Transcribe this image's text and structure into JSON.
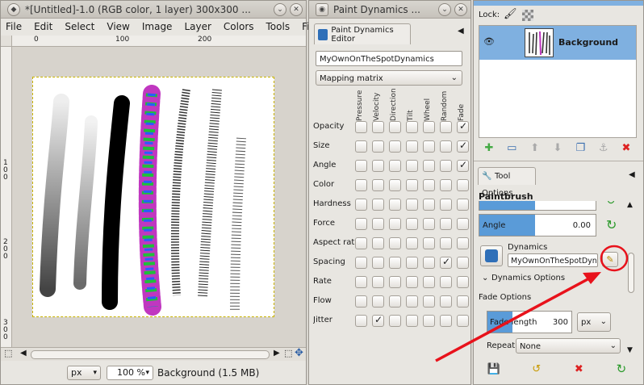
{
  "image_window": {
    "title": "*[Untitled]-1.0 (RGB color, 1 layer) 300x300 ...",
    "menu": [
      "File",
      "Edit",
      "Select",
      "View",
      "Image",
      "Layer",
      "Colors",
      "Tools",
      "Filt"
    ],
    "ruler_top": [
      "0",
      "100",
      "200"
    ],
    "ruler_left": [
      "1\n0\n0",
      "2\n0\n0",
      "3\n0\n0"
    ],
    "unit": "px",
    "zoom": "100 %",
    "status": "Background (1.5 MB)"
  },
  "dynamics_editor": {
    "title": "Paint Dynamics ...",
    "tab_label": "Paint Dynamics Editor",
    "name_value": "MyOwnOnTheSpotDynamics",
    "mode": "Mapping matrix",
    "columns": [
      "Pressure",
      "Velocity",
      "Direction",
      "Tilt",
      "Wheel",
      "Random",
      "Fade"
    ],
    "rows": [
      {
        "label": "Opacity",
        "checks": [
          false,
          false,
          false,
          false,
          false,
          false,
          true
        ]
      },
      {
        "label": "Size",
        "checks": [
          false,
          false,
          false,
          false,
          false,
          false,
          true
        ]
      },
      {
        "label": "Angle",
        "checks": [
          false,
          false,
          false,
          false,
          false,
          false,
          true
        ]
      },
      {
        "label": "Color",
        "checks": [
          false,
          false,
          false,
          false,
          false,
          false,
          false
        ]
      },
      {
        "label": "Hardness",
        "checks": [
          false,
          false,
          false,
          false,
          false,
          false,
          false
        ]
      },
      {
        "label": "Force",
        "checks": [
          false,
          false,
          false,
          false,
          false,
          false,
          false
        ]
      },
      {
        "label": "Aspect ratio",
        "checks": [
          false,
          false,
          false,
          false,
          false,
          false,
          false
        ]
      },
      {
        "label": "Spacing",
        "checks": [
          false,
          false,
          false,
          false,
          false,
          true,
          false
        ]
      },
      {
        "label": "Rate",
        "checks": [
          false,
          false,
          false,
          false,
          false,
          false,
          false
        ]
      },
      {
        "label": "Flow",
        "checks": [
          false,
          false,
          false,
          false,
          false,
          false,
          false
        ]
      },
      {
        "label": "Jitter",
        "checks": [
          false,
          true,
          false,
          false,
          false,
          false,
          false
        ]
      }
    ]
  },
  "layers": {
    "lock_label": "Lock:",
    "layer_name": "Background"
  },
  "tool_options": {
    "tab_label": "Tool Options",
    "tool_name": "Paintbrush",
    "angle_label": "Angle",
    "angle_value": "0.00",
    "dynamics_label": "Dynamics",
    "dynamics_value": "MyOwnOnTheSpotDynam",
    "dynamics_options_label": "Dynamics Options",
    "fade_options_label": "Fade Options",
    "fade_length_label": "Fade length",
    "fade_length_value": "300",
    "fade_unit": "px",
    "repeat_label": "Repeat:",
    "repeat_value": "None"
  },
  "colors": {
    "annotation": "#e8121b",
    "selection_blue": "#7fb0e0",
    "slider_blue": "#5a9bd8"
  }
}
